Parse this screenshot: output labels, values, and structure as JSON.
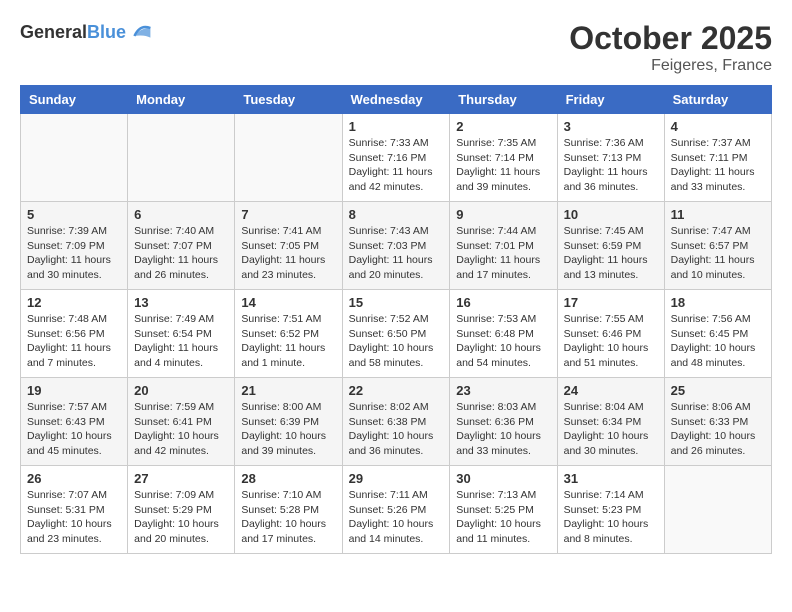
{
  "header": {
    "logo_general": "General",
    "logo_blue": "Blue",
    "month": "October 2025",
    "location": "Feigeres, France"
  },
  "days_of_week": [
    "Sunday",
    "Monday",
    "Tuesday",
    "Wednesday",
    "Thursday",
    "Friday",
    "Saturday"
  ],
  "weeks": [
    [
      {
        "day": "",
        "info": ""
      },
      {
        "day": "",
        "info": ""
      },
      {
        "day": "",
        "info": ""
      },
      {
        "day": "1",
        "info": "Sunrise: 7:33 AM\nSunset: 7:16 PM\nDaylight: 11 hours and 42 minutes."
      },
      {
        "day": "2",
        "info": "Sunrise: 7:35 AM\nSunset: 7:14 PM\nDaylight: 11 hours and 39 minutes."
      },
      {
        "day": "3",
        "info": "Sunrise: 7:36 AM\nSunset: 7:13 PM\nDaylight: 11 hours and 36 minutes."
      },
      {
        "day": "4",
        "info": "Sunrise: 7:37 AM\nSunset: 7:11 PM\nDaylight: 11 hours and 33 minutes."
      }
    ],
    [
      {
        "day": "5",
        "info": "Sunrise: 7:39 AM\nSunset: 7:09 PM\nDaylight: 11 hours and 30 minutes."
      },
      {
        "day": "6",
        "info": "Sunrise: 7:40 AM\nSunset: 7:07 PM\nDaylight: 11 hours and 26 minutes."
      },
      {
        "day": "7",
        "info": "Sunrise: 7:41 AM\nSunset: 7:05 PM\nDaylight: 11 hours and 23 minutes."
      },
      {
        "day": "8",
        "info": "Sunrise: 7:43 AM\nSunset: 7:03 PM\nDaylight: 11 hours and 20 minutes."
      },
      {
        "day": "9",
        "info": "Sunrise: 7:44 AM\nSunset: 7:01 PM\nDaylight: 11 hours and 17 minutes."
      },
      {
        "day": "10",
        "info": "Sunrise: 7:45 AM\nSunset: 6:59 PM\nDaylight: 11 hours and 13 minutes."
      },
      {
        "day": "11",
        "info": "Sunrise: 7:47 AM\nSunset: 6:57 PM\nDaylight: 11 hours and 10 minutes."
      }
    ],
    [
      {
        "day": "12",
        "info": "Sunrise: 7:48 AM\nSunset: 6:56 PM\nDaylight: 11 hours and 7 minutes."
      },
      {
        "day": "13",
        "info": "Sunrise: 7:49 AM\nSunset: 6:54 PM\nDaylight: 11 hours and 4 minutes."
      },
      {
        "day": "14",
        "info": "Sunrise: 7:51 AM\nSunset: 6:52 PM\nDaylight: 11 hours and 1 minute."
      },
      {
        "day": "15",
        "info": "Sunrise: 7:52 AM\nSunset: 6:50 PM\nDaylight: 10 hours and 58 minutes."
      },
      {
        "day": "16",
        "info": "Sunrise: 7:53 AM\nSunset: 6:48 PM\nDaylight: 10 hours and 54 minutes."
      },
      {
        "day": "17",
        "info": "Sunrise: 7:55 AM\nSunset: 6:46 PM\nDaylight: 10 hours and 51 minutes."
      },
      {
        "day": "18",
        "info": "Sunrise: 7:56 AM\nSunset: 6:45 PM\nDaylight: 10 hours and 48 minutes."
      }
    ],
    [
      {
        "day": "19",
        "info": "Sunrise: 7:57 AM\nSunset: 6:43 PM\nDaylight: 10 hours and 45 minutes."
      },
      {
        "day": "20",
        "info": "Sunrise: 7:59 AM\nSunset: 6:41 PM\nDaylight: 10 hours and 42 minutes."
      },
      {
        "day": "21",
        "info": "Sunrise: 8:00 AM\nSunset: 6:39 PM\nDaylight: 10 hours and 39 minutes."
      },
      {
        "day": "22",
        "info": "Sunrise: 8:02 AM\nSunset: 6:38 PM\nDaylight: 10 hours and 36 minutes."
      },
      {
        "day": "23",
        "info": "Sunrise: 8:03 AM\nSunset: 6:36 PM\nDaylight: 10 hours and 33 minutes."
      },
      {
        "day": "24",
        "info": "Sunrise: 8:04 AM\nSunset: 6:34 PM\nDaylight: 10 hours and 30 minutes."
      },
      {
        "day": "25",
        "info": "Sunrise: 8:06 AM\nSunset: 6:33 PM\nDaylight: 10 hours and 26 minutes."
      }
    ],
    [
      {
        "day": "26",
        "info": "Sunrise: 7:07 AM\nSunset: 5:31 PM\nDaylight: 10 hours and 23 minutes."
      },
      {
        "day": "27",
        "info": "Sunrise: 7:09 AM\nSunset: 5:29 PM\nDaylight: 10 hours and 20 minutes."
      },
      {
        "day": "28",
        "info": "Sunrise: 7:10 AM\nSunset: 5:28 PM\nDaylight: 10 hours and 17 minutes."
      },
      {
        "day": "29",
        "info": "Sunrise: 7:11 AM\nSunset: 5:26 PM\nDaylight: 10 hours and 14 minutes."
      },
      {
        "day": "30",
        "info": "Sunrise: 7:13 AM\nSunset: 5:25 PM\nDaylight: 10 hours and 11 minutes."
      },
      {
        "day": "31",
        "info": "Sunrise: 7:14 AM\nSunset: 5:23 PM\nDaylight: 10 hours and 8 minutes."
      },
      {
        "day": "",
        "info": ""
      }
    ]
  ]
}
